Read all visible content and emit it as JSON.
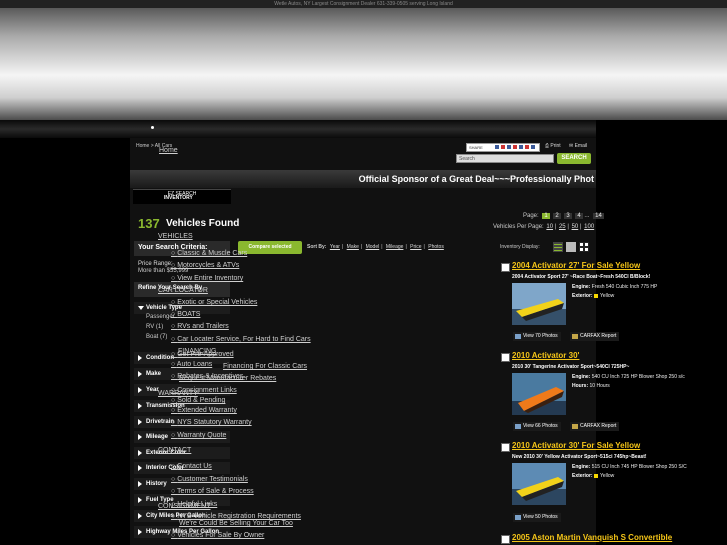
{
  "tagline": "Wetle Autos, NY Largest Consignment Dealer 631-339-0505 serving Long Island",
  "breadcrumb": "Home > All Cars",
  "top_links": {
    "share": "SHARE",
    "print": "Print",
    "email": "Email"
  },
  "search": {
    "placeholder": "Search",
    "button": "SEARCH"
  },
  "sponsor": "Official Sponsor of a Great Deal~~~Professionally Phot",
  "tab_ez": "EZ SEARCH",
  "nav": {
    "home": "Home",
    "inventory": "INVENTORY",
    "vehicles": "VEHICLES",
    "items": [
      "Classic & Muscle Cars",
      "Motorcycles & ATVs",
      "View Entire Inventory",
      "CAR LOCATOR",
      "Exotic or Special Vehicles",
      "BOATS",
      "RVs and Trailers",
      "Car Locater Service, For Hard to Find Cars",
      "FINANCING",
      "Get Pre-Approved",
      "Auto Loans",
      "Financing For Classic Cars",
      "Rebates & Incentives",
      "Request Manufacturer Rebates",
      "Consignment Links",
      "Sold & Pending",
      "WARRANTY",
      "Extended Warranty",
      "NYS Statutory Warranty",
      "Warranty Quote",
      "CONTACT",
      "Contact Us",
      "Customer Testimonials",
      "Terms of Sale & Process",
      "CONSIGNMENT",
      "Helpful Links",
      "NYS Vehicle Registration Requirements",
      "We're Could Be Selling Your Car Too",
      "Vehicles For Sale By Owner"
    ]
  },
  "results": {
    "count": "137",
    "label": "Vehicles Found"
  },
  "pager": {
    "label": "Page:",
    "pages": [
      "1",
      "2",
      "3",
      "4",
      "...",
      "14"
    ]
  },
  "per_page": {
    "label": "Vehicles Per Page:",
    "options": [
      "10",
      "25",
      "50",
      "100"
    ]
  },
  "left": {
    "criteria_head": "Your Search Criteria:",
    "price_label": "Price Range:",
    "price_value": "More than $55,999",
    "refine_head": "Refine Your Search By",
    "facets": [
      "Vehicle Type",
      "Condition",
      "Make",
      "Year",
      "Transmission",
      "Drivetrain",
      "Mileage",
      "Exterior Color",
      "Interior Color",
      "History",
      "Fuel Type",
      "City Miles Per Gallon",
      "Highway Miles Per Gallon"
    ],
    "sub_facets": [
      "Passenger",
      "RV (1)",
      "Boat (7)"
    ]
  },
  "toolbar": {
    "compare": "Compare selected",
    "sort_by": "Sort By:",
    "sort_options": [
      "Year",
      "Make",
      "Model",
      "Mileage",
      "Price",
      "Photos"
    ],
    "display": "Inventory Display:"
  },
  "listings": [
    {
      "title": "2004 Activator 27' For Sale Yellow",
      "subtitle": "2004 Activator Sport 27' ~Race Boat~Fresh 540CI B/Block!",
      "engine_label": "Engine:",
      "engine": "Fresh 540 Cubic Inch 775 HP",
      "spec2_label": "Exterior:",
      "spec2": "Yellow",
      "photos": "View 70 Photos",
      "carfax": "CARFAX Report"
    },
    {
      "title": "2010 Activator 30'",
      "subtitle": "2010 30' Tangerine Activator Sport~540CI 725HP~",
      "engine_label": "Engine:",
      "engine": "540 CU Inch 725 HP Blower Shop 250 s/c",
      "spec2_label": "Hours:",
      "spec2": "10 Hours",
      "photos": "View 66 Photos",
      "carfax": "CARFAX Report"
    },
    {
      "title": "2010 Activator 30' For Sale Yellow",
      "subtitle": "New 2010 30' Yellow Activator Sport~515ci 745hp~Beast!",
      "engine_label": "Engine:",
      "engine": "515 CU Inch 745 HP Blower Shop 250 S/C",
      "spec2_label": "Exterior:",
      "spec2": "Yellow",
      "photos": "View 50 Photos",
      "carfax": ""
    },
    {
      "title": "2005 Aston Martin Vanquish S Convertible"
    }
  ]
}
